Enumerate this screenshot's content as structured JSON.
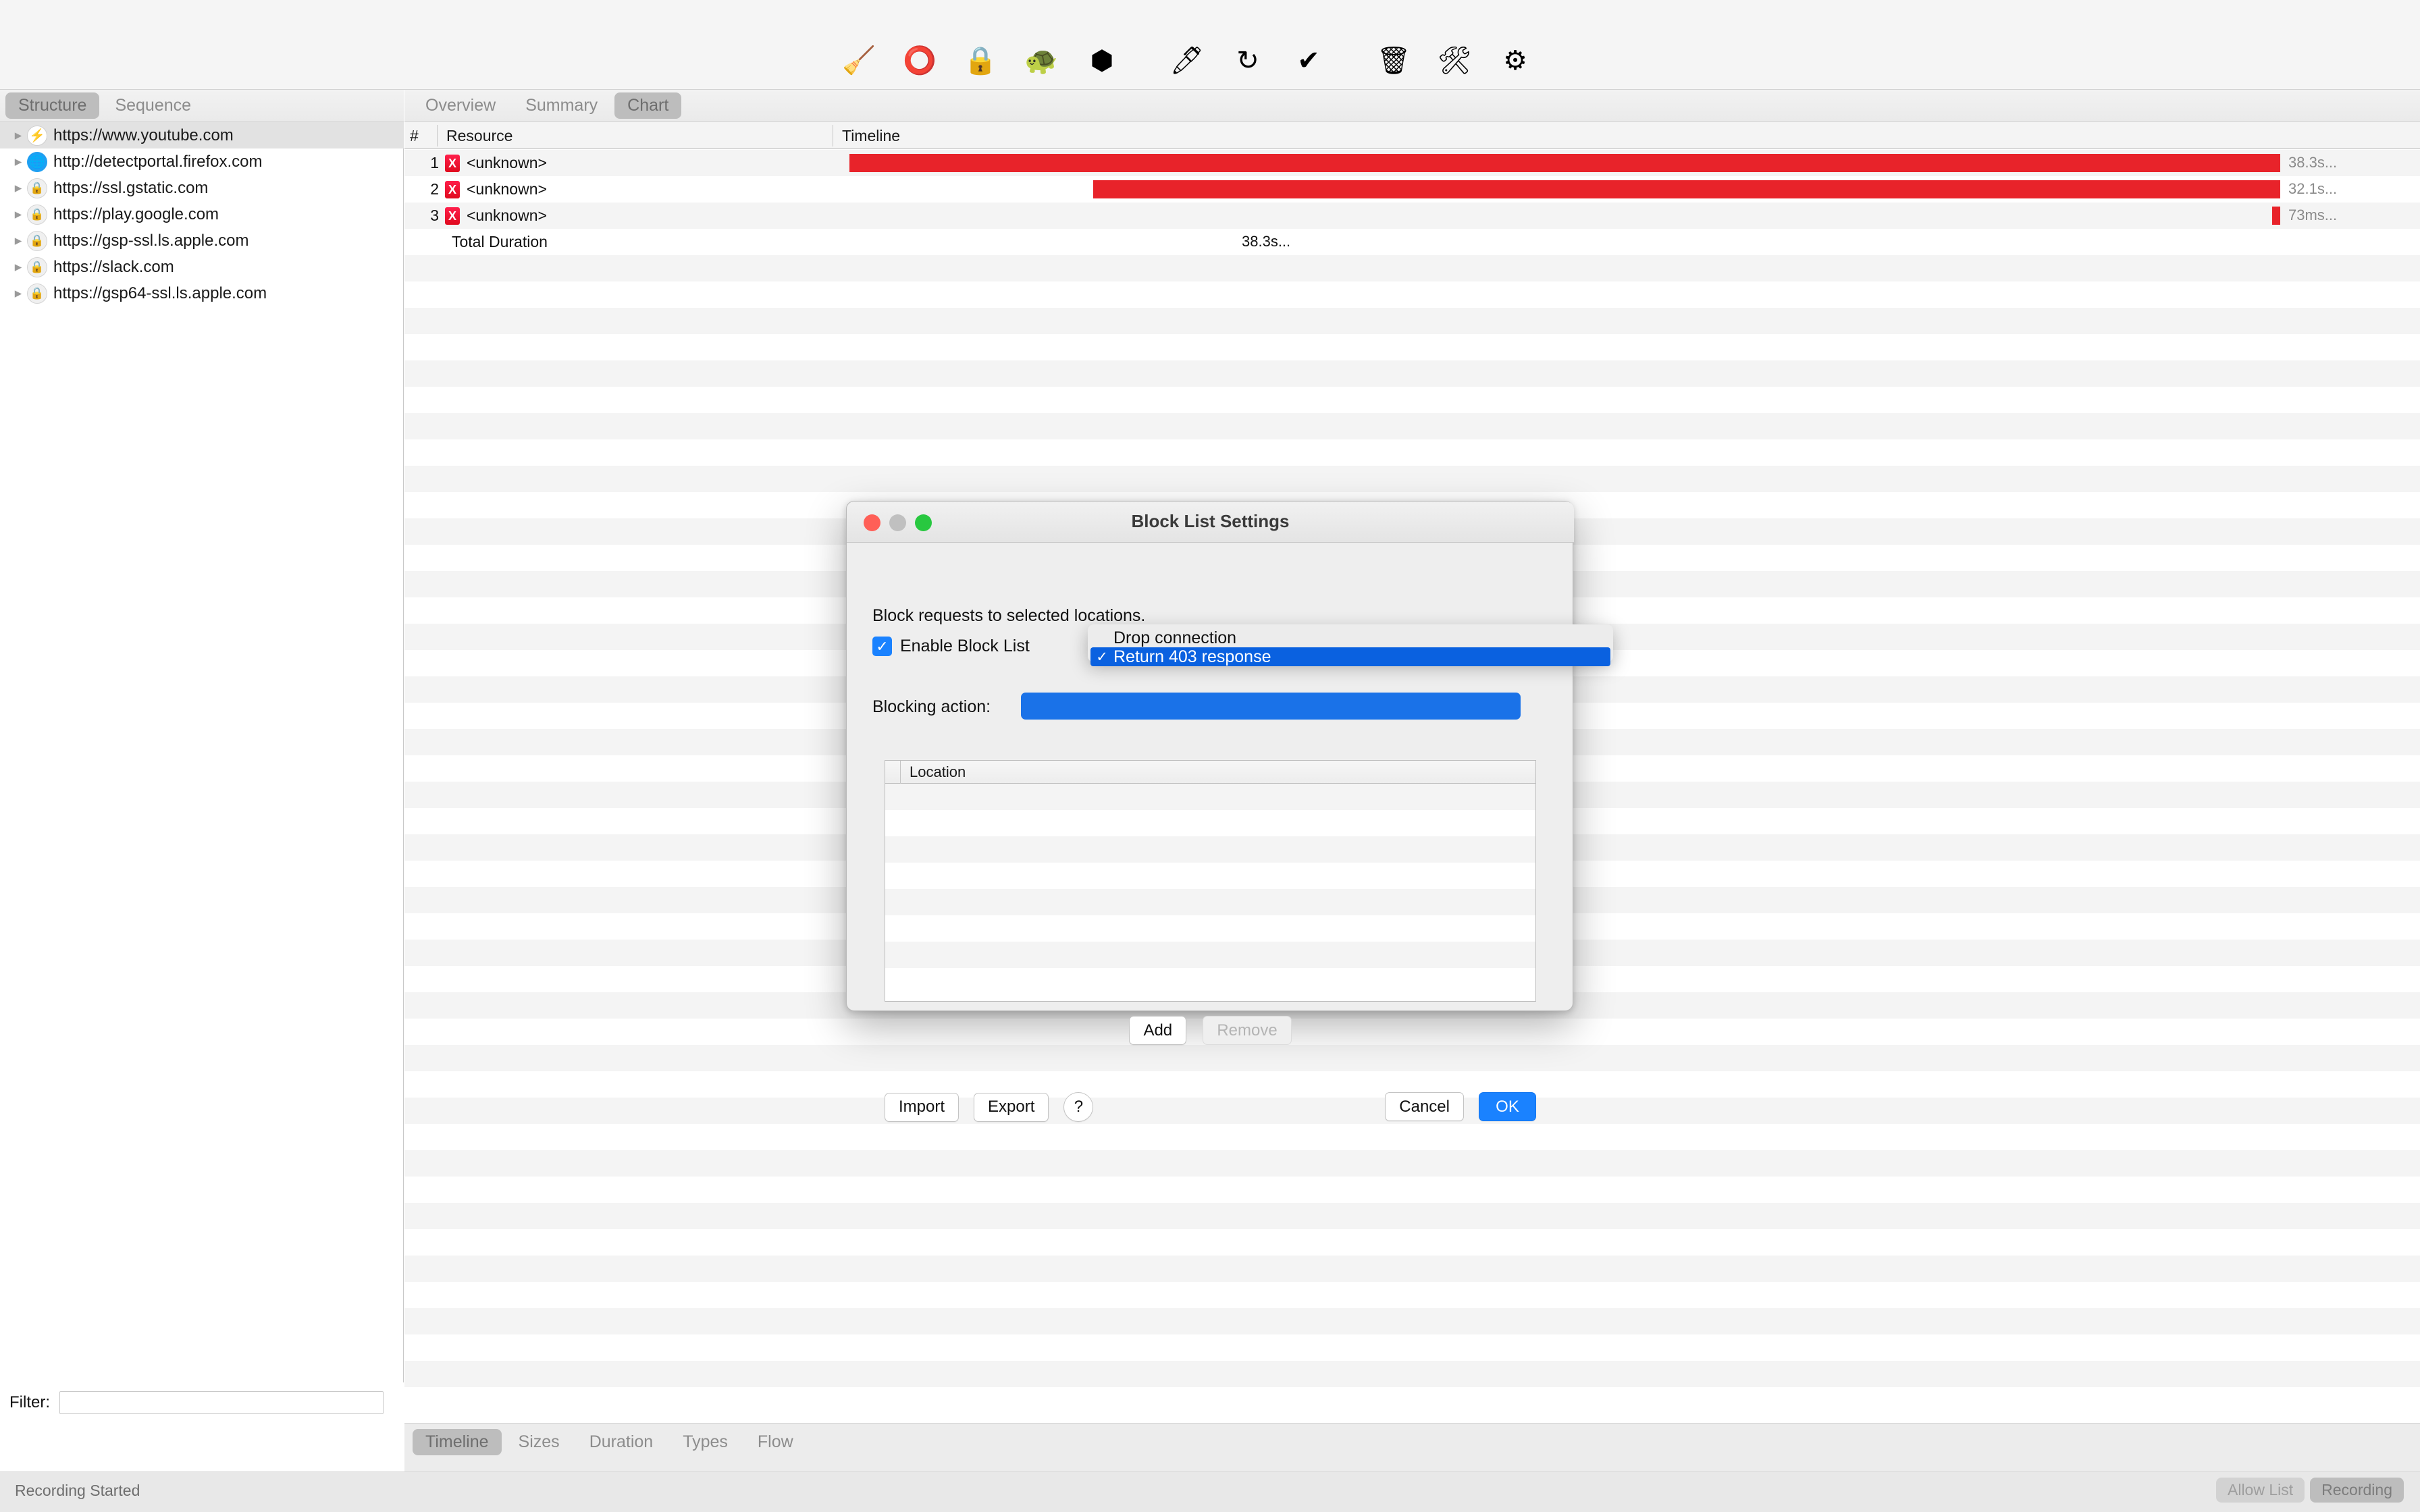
{
  "toolbar": {
    "items": [
      {
        "name": "clear-icon",
        "glyph": "🧹",
        "label": "Clear"
      },
      {
        "name": "record-icon",
        "glyph": "⭕",
        "label": "Start/Stop Recording"
      },
      {
        "name": "ssl-proxy-icon",
        "glyph": "🔒",
        "label": "SSL Proxying"
      },
      {
        "name": "throttle-icon",
        "glyph": "🐢",
        "label": "Throttle"
      },
      {
        "name": "breakpoint-icon",
        "glyph": "⬢",
        "label": "Breakpoints"
      },
      {
        "name": "compose-icon",
        "glyph": "🖊",
        "label": "Compose"
      },
      {
        "name": "repeat-icon",
        "glyph": "↻",
        "label": "Repeat"
      },
      {
        "name": "validate-icon",
        "glyph": "✔",
        "label": "Validate"
      },
      {
        "name": "trash-icon",
        "glyph": "🗑",
        "label": "Delete"
      },
      {
        "name": "tools-icon",
        "glyph": "🛠",
        "label": "Tools"
      },
      {
        "name": "settings-icon",
        "glyph": "⚙",
        "label": "Settings"
      }
    ]
  },
  "left_pane": {
    "tabs": [
      {
        "label": "Structure",
        "active": true
      },
      {
        "label": "Sequence",
        "active": false
      }
    ],
    "tree": [
      {
        "label": "https://www.youtube.com",
        "icon": "bolt",
        "selected": true
      },
      {
        "label": "http://detectportal.firefox.com",
        "icon": "globe",
        "selected": false
      },
      {
        "label": "https://ssl.gstatic.com",
        "icon": "lock",
        "selected": false
      },
      {
        "label": "https://play.google.com",
        "icon": "lock",
        "selected": false
      },
      {
        "label": "https://gsp-ssl.ls.apple.com",
        "icon": "lock",
        "selected": false
      },
      {
        "label": "https://slack.com",
        "icon": "lock",
        "selected": false
      },
      {
        "label": "https://gsp64-ssl.ls.apple.com",
        "icon": "lock",
        "selected": false
      }
    ],
    "filter": {
      "label": "Filter:",
      "value": "",
      "placeholder": ""
    }
  },
  "right_pane": {
    "tabs": [
      {
        "label": "Overview",
        "active": false
      },
      {
        "label": "Summary",
        "active": false
      },
      {
        "label": "Chart",
        "active": true
      }
    ],
    "columns": {
      "num": "#",
      "resource": "Resource",
      "timeline": "Timeline"
    },
    "rows": [
      {
        "num": "1",
        "status": "X",
        "resource": "<unknown>",
        "bar_start_pct": 22.1,
        "bar_end_pct": 93.0,
        "duration": "38.3s..."
      },
      {
        "num": "2",
        "status": "X",
        "resource": "<unknown>",
        "bar_start_pct": 34.2,
        "bar_end_pct": 93.0,
        "duration": "32.1s..."
      },
      {
        "num": "3",
        "status": "X",
        "resource": "<unknown>",
        "bar_start_pct": 92.5,
        "bar_end_pct": 93.0,
        "duration": "73ms..."
      }
    ],
    "total_row": {
      "label": "Total Duration",
      "value": "38.3s..."
    }
  },
  "chart_data": {
    "type": "bar",
    "title": "Chart",
    "xlabel": "Timeline",
    "ylabel": "Resource",
    "categories": [
      "1 <unknown>",
      "2 <unknown>",
      "3 <unknown>"
    ],
    "values": [
      38.3,
      32.1,
      0.073
    ],
    "value_labels": [
      "38.3s...",
      "32.1s...",
      "73ms..."
    ],
    "units": "seconds",
    "total_duration": "38.3s...",
    "grid": false,
    "legend": "none",
    "bar_color": "#e8232a"
  },
  "bottom_tabs": [
    {
      "label": "Timeline",
      "active": true
    },
    {
      "label": "Sizes",
      "active": false
    },
    {
      "label": "Duration",
      "active": false
    },
    {
      "label": "Types",
      "active": false
    },
    {
      "label": "Flow",
      "active": false
    }
  ],
  "statusbar": {
    "message": "Recording Started",
    "buttons": [
      {
        "label": "Allow List",
        "state": "off"
      },
      {
        "label": "Recording",
        "state": "on"
      }
    ]
  },
  "dialog": {
    "title": "Block List Settings",
    "description": "Block requests to selected locations.",
    "enable_checkbox": {
      "label": "Enable Block List",
      "checked": true,
      "check_glyph": "✓"
    },
    "blocking_action": {
      "label": "Blocking action:",
      "value": "Return 403 response"
    },
    "dropdown": {
      "open": true,
      "options": [
        {
          "label": "Drop connection",
          "selected": false
        },
        {
          "label": "Return 403 response",
          "selected": true
        }
      ],
      "check_glyph": "✓"
    },
    "location_table": {
      "header": "Location",
      "rows": []
    },
    "list_buttons": [
      {
        "name": "add-button",
        "label": "Add",
        "disabled": false
      },
      {
        "name": "remove-button",
        "label": "Remove",
        "disabled": true
      }
    ],
    "footer": {
      "import_label": "Import",
      "export_label": "Export",
      "help_label": "?",
      "cancel_label": "Cancel",
      "ok_label": "OK"
    }
  },
  "colors": {
    "accent_blue": "#1a82ff",
    "menu_highlight": "#0a61e0",
    "bar_red": "#e8232a",
    "error_badge": "#e00a1e"
  }
}
